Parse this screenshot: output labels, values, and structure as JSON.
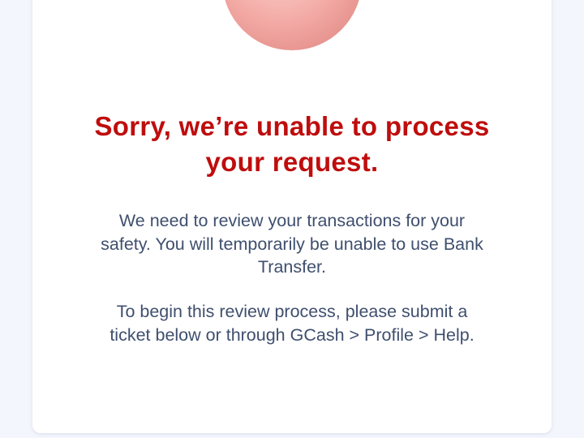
{
  "colors": {
    "page_background": "#f3f6fd",
    "card_background": "#ffffff",
    "title": "#bf0d0d",
    "body_text": "#3f4f6e",
    "illustration_face": "#f1a7a3"
  },
  "illustration": {
    "icon": "sad-face-icon"
  },
  "error": {
    "title": "Sorry, we’re unable to process your request.",
    "message": "We need to review your transactions for your safety. You will temporarily be unable to use Bank Transfer.",
    "instruction": "To begin this review process, please submit a ticket below or through GCash > Profile > Help."
  }
}
